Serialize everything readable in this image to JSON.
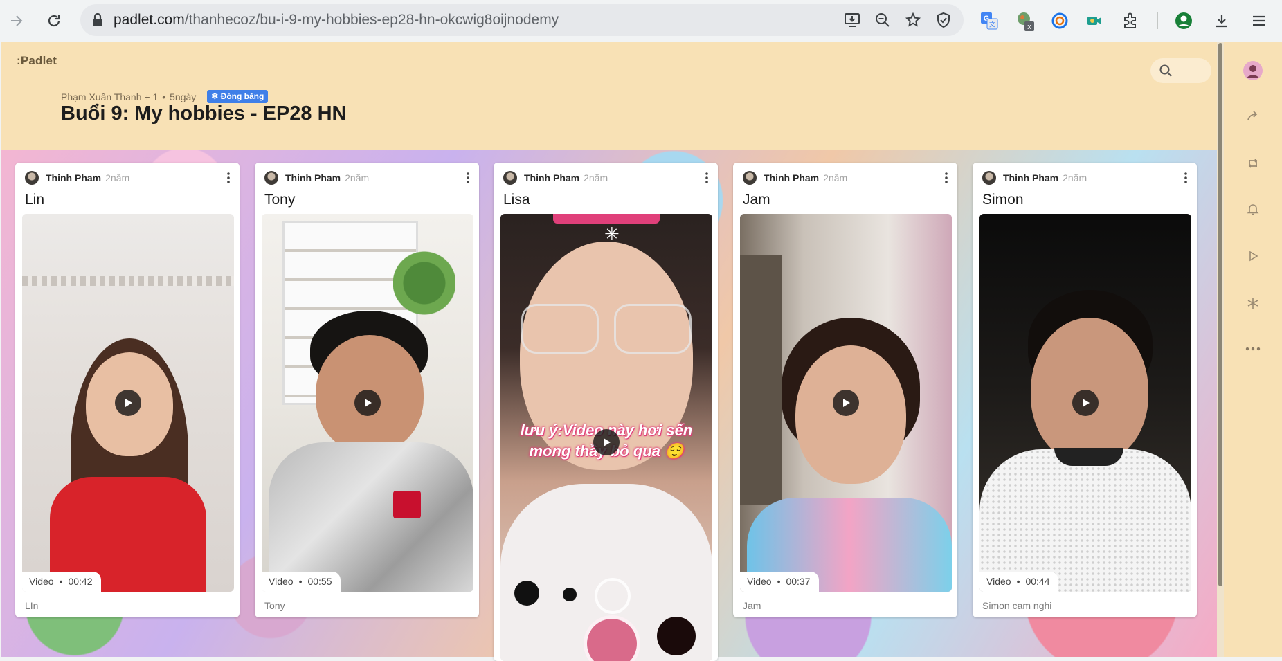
{
  "browser": {
    "url_domain": "padlet.com",
    "url_path": "/thanhecoz/bu-i-9-my-hobbies-ep28-hn-okcwig8oijnodemy"
  },
  "padlet": {
    "logo": ":Padlet",
    "authors": "Phạm Xuân Thanh + 1",
    "separator": "•",
    "age": "5ngày",
    "frozen_badge": "❄ Đóng băng",
    "title": "Buổi 9: My hobbies - EP28 HN"
  },
  "posts": [
    {
      "author": "Thinh Pham",
      "age": "2năm",
      "title": "Lin",
      "media_type": "Video",
      "duration": "00:42",
      "caption": "LIn"
    },
    {
      "author": "Thinh Pham",
      "age": "2năm",
      "title": "Tony",
      "media_type": "Video",
      "duration": "00:55",
      "caption": "Tony"
    },
    {
      "author": "Thinh Pham",
      "age": "2năm",
      "title": "Lisa",
      "overlay_text": "lưu ý:Video này hơi sến mong thầy bỏ qua 😌"
    },
    {
      "author": "Thinh Pham",
      "age": "2năm",
      "title": "Jam",
      "media_type": "Video",
      "duration": "00:37",
      "caption": "Jam"
    },
    {
      "author": "Thinh Pham",
      "age": "2năm",
      "title": "Simon",
      "media_type": "Video",
      "duration": "00:44",
      "caption": "Simon cam nghi"
    }
  ],
  "video_dot": "•"
}
